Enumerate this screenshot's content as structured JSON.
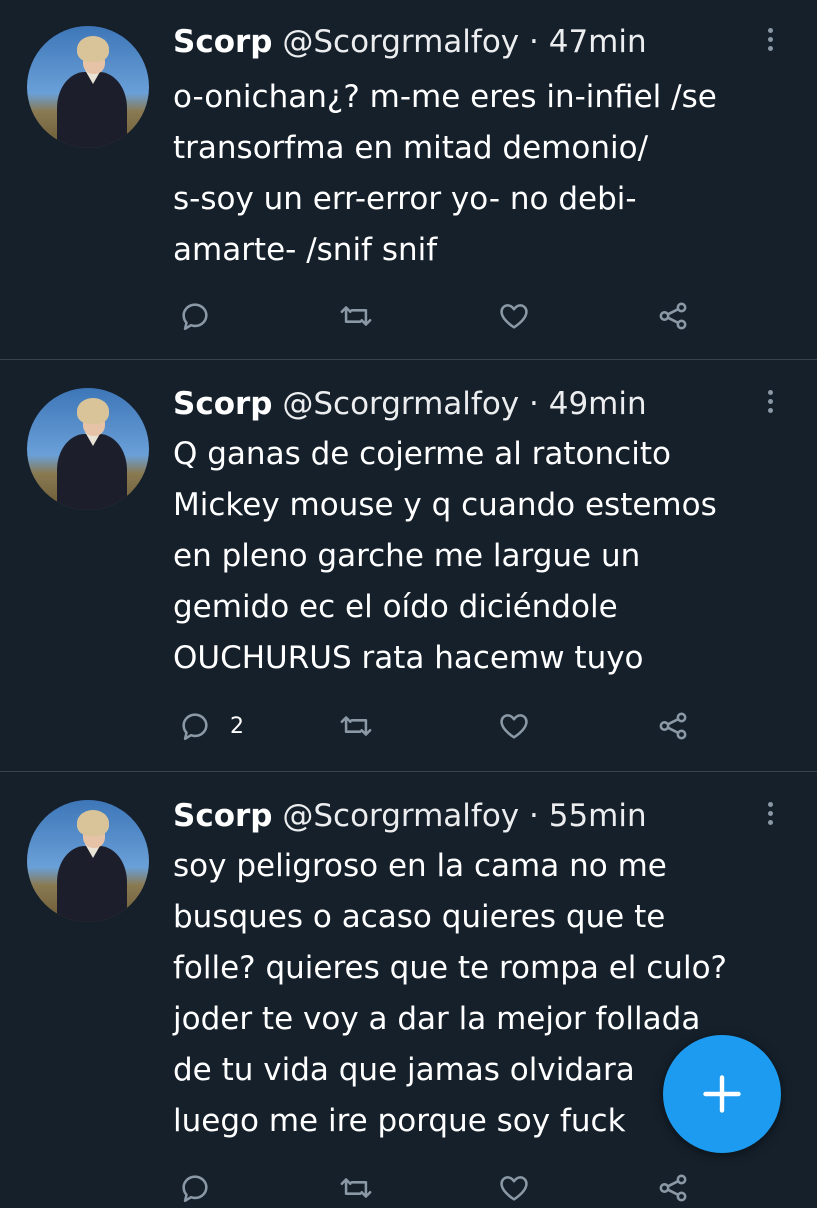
{
  "theme": {
    "background": "#15202b",
    "accent": "#1d9bf0",
    "icon_color": "#8b98a5",
    "divider": "#38444d"
  },
  "tweets": [
    {
      "name": "Scorp",
      "handle": "@Scorgrmalfoy",
      "separator": "·",
      "time": "47min",
      "text": "o-onichan¿? m-me eres in-infiel /se\ntransorfma en mitad demonio/\ns-soy un err-error yo- no debi-\namarte- /snif snif",
      "reply_count": ""
    },
    {
      "name": "Scorp",
      "handle": "@Scorgrmalfoy",
      "separator": "·",
      "time": "49min",
      "text": "Q ganas de cojerme al ratoncito\nMickey mouse y q cuando estemos\nen pleno garche me largue un\ngemido ec el oído diciéndole\nOUCHURUS rata hacemw tuyo",
      "reply_count": "2"
    },
    {
      "name": "Scorp",
      "handle": "@Scorgrmalfoy",
      "separator": "·",
      "time": "55min",
      "text": "soy peligroso en la cama no me\nbusques o acaso quieres que te\nfolle? quieres que te rompa el culo?\njoder te voy a dar la mejor follada\nde tu vida que jamas olvidara\nluego me ire porque soy fuck",
      "reply_count": ""
    }
  ],
  "icons": {
    "reply": "reply-icon",
    "retweet": "retweet-icon",
    "like": "heart-icon",
    "share": "share-icon",
    "more": "more-vertical-icon",
    "compose": "plus-icon"
  }
}
